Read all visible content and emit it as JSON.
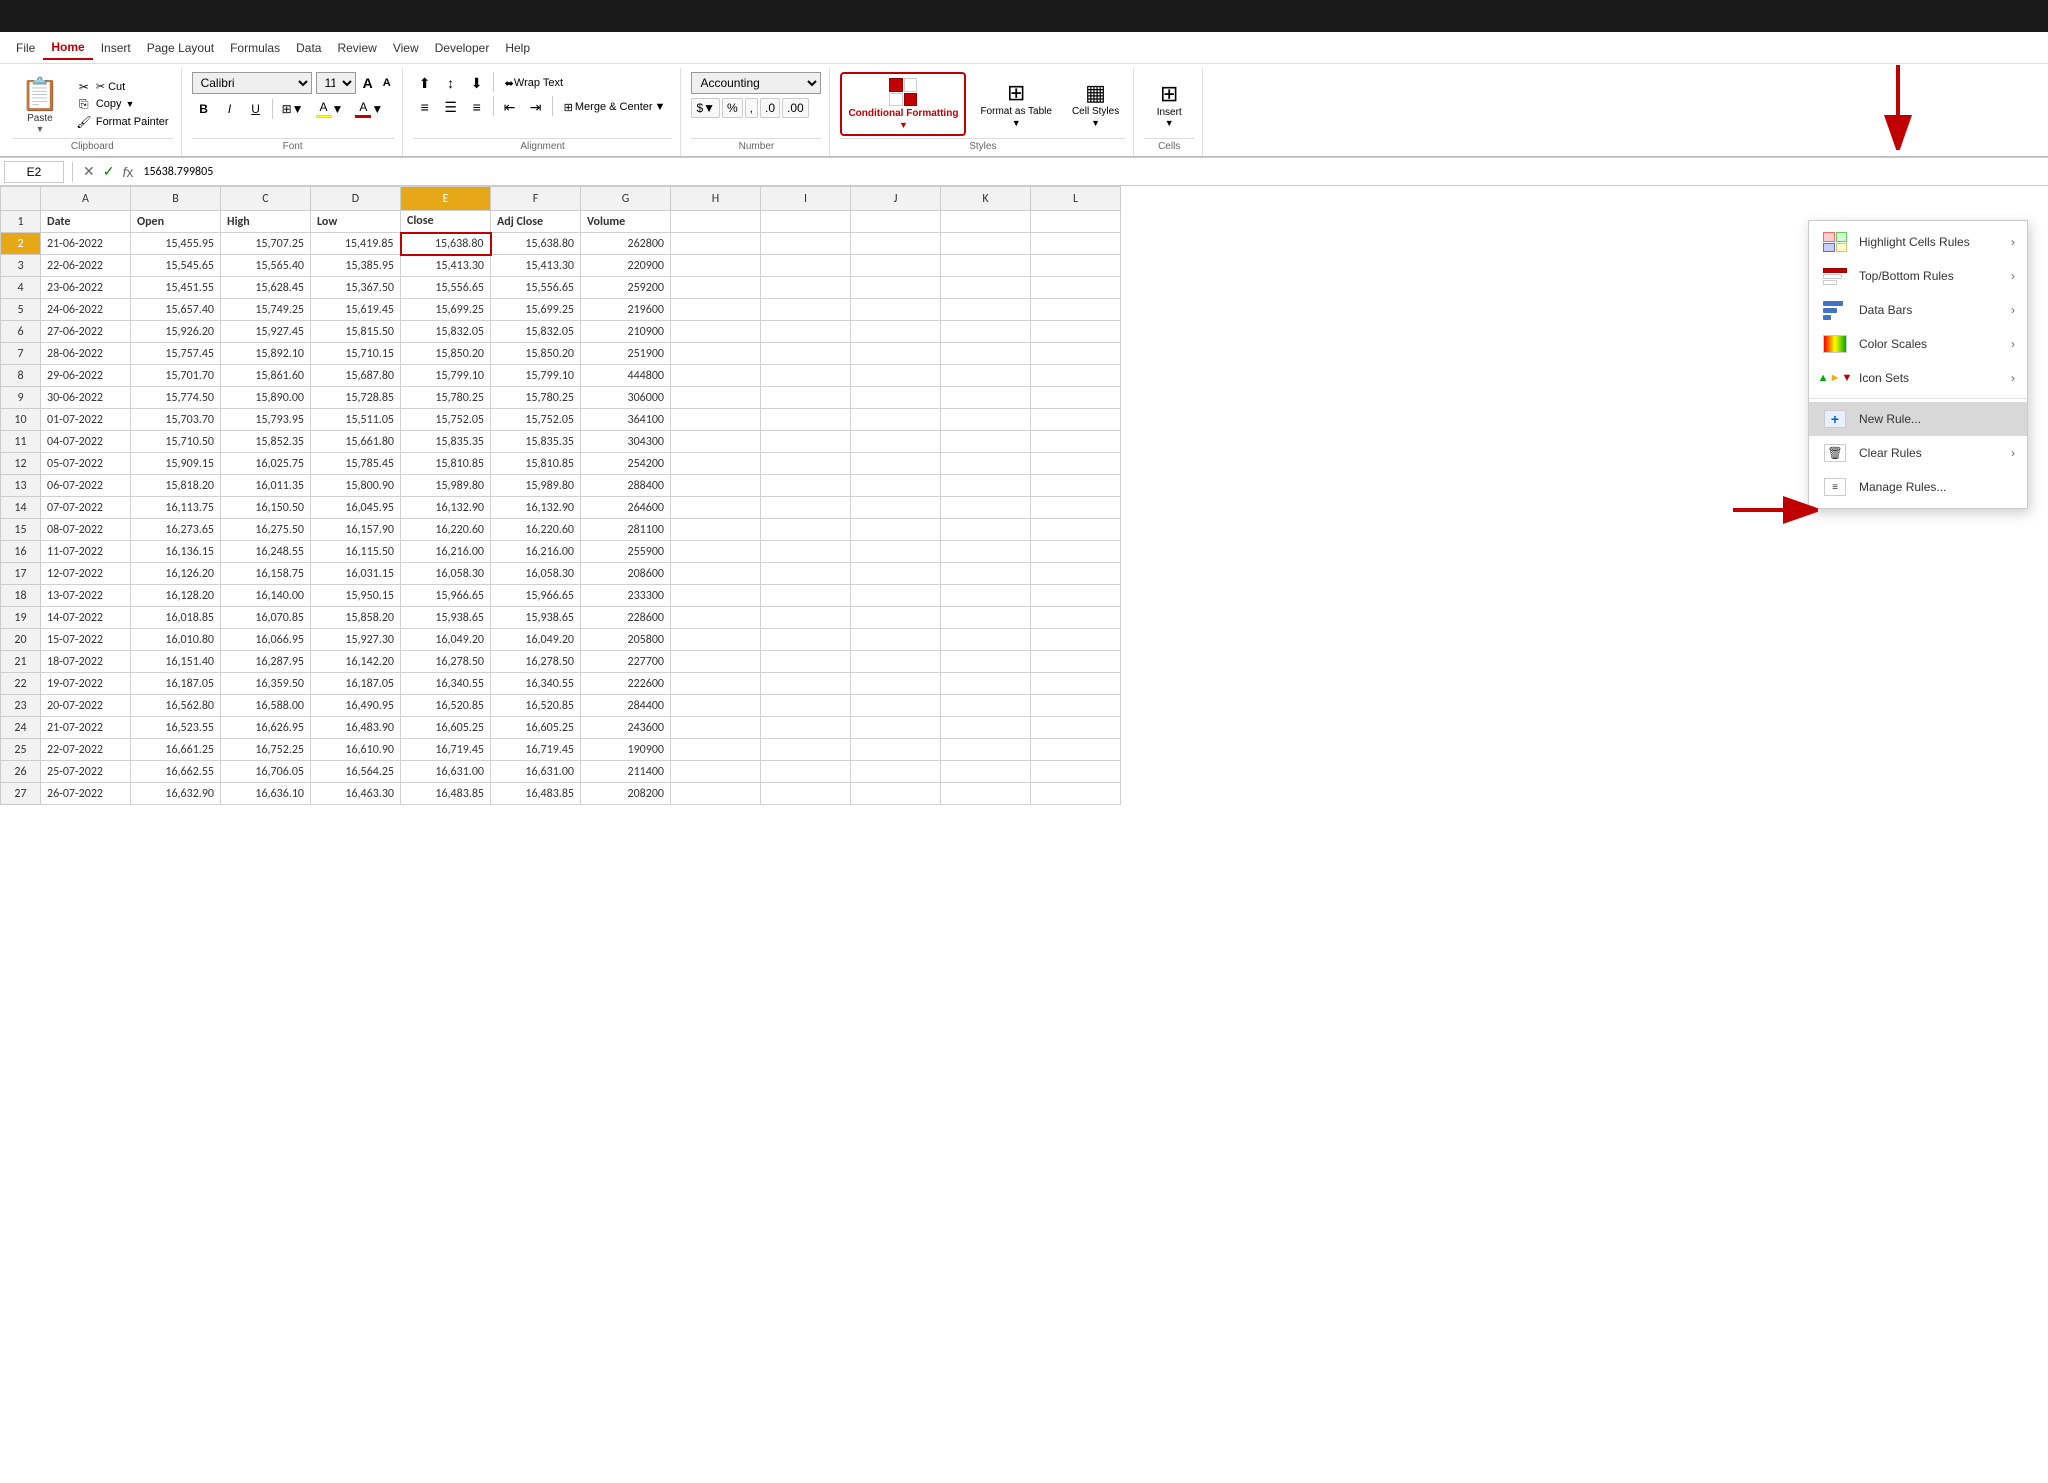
{
  "titlebar": {
    "text": ""
  },
  "menubar": {
    "items": [
      "File",
      "Home",
      "Insert",
      "Page Layout",
      "Formulas",
      "Data",
      "Review",
      "View",
      "Developer",
      "Help"
    ],
    "active": "Home"
  },
  "ribbon": {
    "groups": {
      "clipboard": {
        "label": "Clipboard",
        "paste": "Paste",
        "cut": "✂ Cut",
        "copy": "Copy",
        "format_painter": "Format Painter"
      },
      "font": {
        "label": "Font",
        "font_name": "Calibri",
        "font_size": "11",
        "bold": "B",
        "italic": "I",
        "underline": "U"
      },
      "alignment": {
        "label": "Alignment",
        "wrap_text": "Wrap Text",
        "merge_center": "Merge & Center"
      },
      "number": {
        "label": "Number",
        "format": "Accounting",
        "percent": "%",
        "comma": ","
      },
      "styles": {
        "label": "Styles",
        "conditional_formatting": "Conditional\nFormatting",
        "format_as_table": "Format as\nTable",
        "cell_styles": "Cell\nStyles"
      },
      "cells": {
        "label": "Cells",
        "insert": "Insert"
      }
    }
  },
  "formula_bar": {
    "cell_ref": "E2",
    "formula": "15638.799805"
  },
  "columns": [
    "",
    "A",
    "B",
    "C",
    "D",
    "E",
    "F",
    "G",
    "H",
    "I",
    "J",
    "K",
    "L"
  ],
  "col_headers": {
    "selected_col": "E"
  },
  "rows": [
    {
      "num": 1,
      "cells": [
        "Date",
        "Open",
        "High",
        "Low",
        "Close",
        "Adj Close",
        "Volume",
        "",
        "",
        "",
        "",
        ""
      ]
    },
    {
      "num": 2,
      "cells": [
        "21-06-2022",
        "15,455.95",
        "15,707.25",
        "15,419.85",
        "15,638.80",
        "15,638.80",
        "262800",
        "",
        "",
        "",
        "",
        ""
      ]
    },
    {
      "num": 3,
      "cells": [
        "22-06-2022",
        "15,545.65",
        "15,565.40",
        "15,385.95",
        "15,413.30",
        "15,413.30",
        "220900",
        "",
        "",
        "",
        "",
        ""
      ]
    },
    {
      "num": 4,
      "cells": [
        "23-06-2022",
        "15,451.55",
        "15,628.45",
        "15,367.50",
        "15,556.65",
        "15,556.65",
        "259200",
        "",
        "",
        "",
        "",
        ""
      ]
    },
    {
      "num": 5,
      "cells": [
        "24-06-2022",
        "15,657.40",
        "15,749.25",
        "15,619.45",
        "15,699.25",
        "15,699.25",
        "219600",
        "",
        "",
        "",
        "",
        ""
      ]
    },
    {
      "num": 6,
      "cells": [
        "27-06-2022",
        "15,926.20",
        "15,927.45",
        "15,815.50",
        "15,832.05",
        "15,832.05",
        "210900",
        "",
        "",
        "",
        "",
        ""
      ]
    },
    {
      "num": 7,
      "cells": [
        "28-06-2022",
        "15,757.45",
        "15,892.10",
        "15,710.15",
        "15,850.20",
        "15,850.20",
        "251900",
        "",
        "",
        "",
        "",
        ""
      ]
    },
    {
      "num": 8,
      "cells": [
        "29-06-2022",
        "15,701.70",
        "15,861.60",
        "15,687.80",
        "15,799.10",
        "15,799.10",
        "444800",
        "",
        "",
        "",
        "",
        ""
      ]
    },
    {
      "num": 9,
      "cells": [
        "30-06-2022",
        "15,774.50",
        "15,890.00",
        "15,728.85",
        "15,780.25",
        "15,780.25",
        "306000",
        "",
        "",
        "",
        "",
        ""
      ]
    },
    {
      "num": 10,
      "cells": [
        "01-07-2022",
        "15,703.70",
        "15,793.95",
        "15,511.05",
        "15,752.05",
        "15,752.05",
        "364100",
        "",
        "",
        "",
        "",
        ""
      ]
    },
    {
      "num": 11,
      "cells": [
        "04-07-2022",
        "15,710.50",
        "15,852.35",
        "15,661.80",
        "15,835.35",
        "15,835.35",
        "304300",
        "",
        "",
        "",
        "",
        ""
      ]
    },
    {
      "num": 12,
      "cells": [
        "05-07-2022",
        "15,909.15",
        "16,025.75",
        "15,785.45",
        "15,810.85",
        "15,810.85",
        "254200",
        "",
        "",
        "",
        "",
        ""
      ]
    },
    {
      "num": 13,
      "cells": [
        "06-07-2022",
        "15,818.20",
        "16,011.35",
        "15,800.90",
        "15,989.80",
        "15,989.80",
        "288400",
        "",
        "",
        "",
        "",
        ""
      ]
    },
    {
      "num": 14,
      "cells": [
        "07-07-2022",
        "16,113.75",
        "16,150.50",
        "16,045.95",
        "16,132.90",
        "16,132.90",
        "264600",
        "",
        "",
        "",
        "",
        ""
      ]
    },
    {
      "num": 15,
      "cells": [
        "08-07-2022",
        "16,273.65",
        "16,275.50",
        "16,157.90",
        "16,220.60",
        "16,220.60",
        "281100",
        "",
        "",
        "",
        "",
        ""
      ]
    },
    {
      "num": 16,
      "cells": [
        "11-07-2022",
        "16,136.15",
        "16,248.55",
        "16,115.50",
        "16,216.00",
        "16,216.00",
        "255900",
        "",
        "",
        "",
        "",
        ""
      ]
    },
    {
      "num": 17,
      "cells": [
        "12-07-2022",
        "16,126.20",
        "16,158.75",
        "16,031.15",
        "16,058.30",
        "16,058.30",
        "208600",
        "",
        "",
        "",
        "",
        ""
      ]
    },
    {
      "num": 18,
      "cells": [
        "13-07-2022",
        "16,128.20",
        "16,140.00",
        "15,950.15",
        "15,966.65",
        "15,966.65",
        "233300",
        "",
        "",
        "",
        "",
        ""
      ]
    },
    {
      "num": 19,
      "cells": [
        "14-07-2022",
        "16,018.85",
        "16,070.85",
        "15,858.20",
        "15,938.65",
        "15,938.65",
        "228600",
        "",
        "",
        "",
        "",
        ""
      ]
    },
    {
      "num": 20,
      "cells": [
        "15-07-2022",
        "16,010.80",
        "16,066.95",
        "15,927.30",
        "16,049.20",
        "16,049.20",
        "205800",
        "",
        "",
        "",
        "",
        ""
      ]
    },
    {
      "num": 21,
      "cells": [
        "18-07-2022",
        "16,151.40",
        "16,287.95",
        "16,142.20",
        "16,278.50",
        "16,278.50",
        "227700",
        "",
        "",
        "",
        "",
        ""
      ]
    },
    {
      "num": 22,
      "cells": [
        "19-07-2022",
        "16,187.05",
        "16,359.50",
        "16,187.05",
        "16,340.55",
        "16,340.55",
        "222600",
        "",
        "",
        "",
        "",
        ""
      ]
    },
    {
      "num": 23,
      "cells": [
        "20-07-2022",
        "16,562.80",
        "16,588.00",
        "16,490.95",
        "16,520.85",
        "16,520.85",
        "284400",
        "",
        "",
        "",
        "",
        ""
      ]
    },
    {
      "num": 24,
      "cells": [
        "21-07-2022",
        "16,523.55",
        "16,626.95",
        "16,483.90",
        "16,605.25",
        "16,605.25",
        "243600",
        "",
        "",
        "",
        "",
        ""
      ]
    },
    {
      "num": 25,
      "cells": [
        "22-07-2022",
        "16,661.25",
        "16,752.25",
        "16,610.90",
        "16,719.45",
        "16,719.45",
        "190900",
        "",
        "",
        "",
        "",
        ""
      ]
    },
    {
      "num": 26,
      "cells": [
        "25-07-2022",
        "16,662.55",
        "16,706.05",
        "16,564.25",
        "16,631.00",
        "16,631.00",
        "211400",
        "",
        "",
        "",
        "",
        ""
      ]
    },
    {
      "num": 27,
      "cells": [
        "26-07-2022",
        "16,632.90",
        "16,636.10",
        "16,463.30",
        "16,483.85",
        "16,483.85",
        "208200",
        "",
        "",
        "",
        "",
        ""
      ]
    }
  ],
  "dropdown": {
    "items": [
      {
        "id": "highlight",
        "label": "Highlight Cells Rules",
        "has_arrow": true
      },
      {
        "id": "topbottom",
        "label": "Top/Bottom Rules",
        "has_arrow": true
      },
      {
        "id": "databars",
        "label": "Data Bars",
        "has_arrow": true
      },
      {
        "id": "colorscales",
        "label": "Color Scales",
        "has_arrow": true
      },
      {
        "id": "iconsets",
        "label": "Icon Sets",
        "has_arrow": true
      },
      {
        "id": "newrule",
        "label": "New Rule...",
        "has_arrow": false,
        "highlighted": true
      },
      {
        "id": "clearrules",
        "label": "Clear Rules",
        "has_arrow": true
      },
      {
        "id": "managerules",
        "label": "Manage Rules...",
        "has_arrow": false
      }
    ]
  }
}
